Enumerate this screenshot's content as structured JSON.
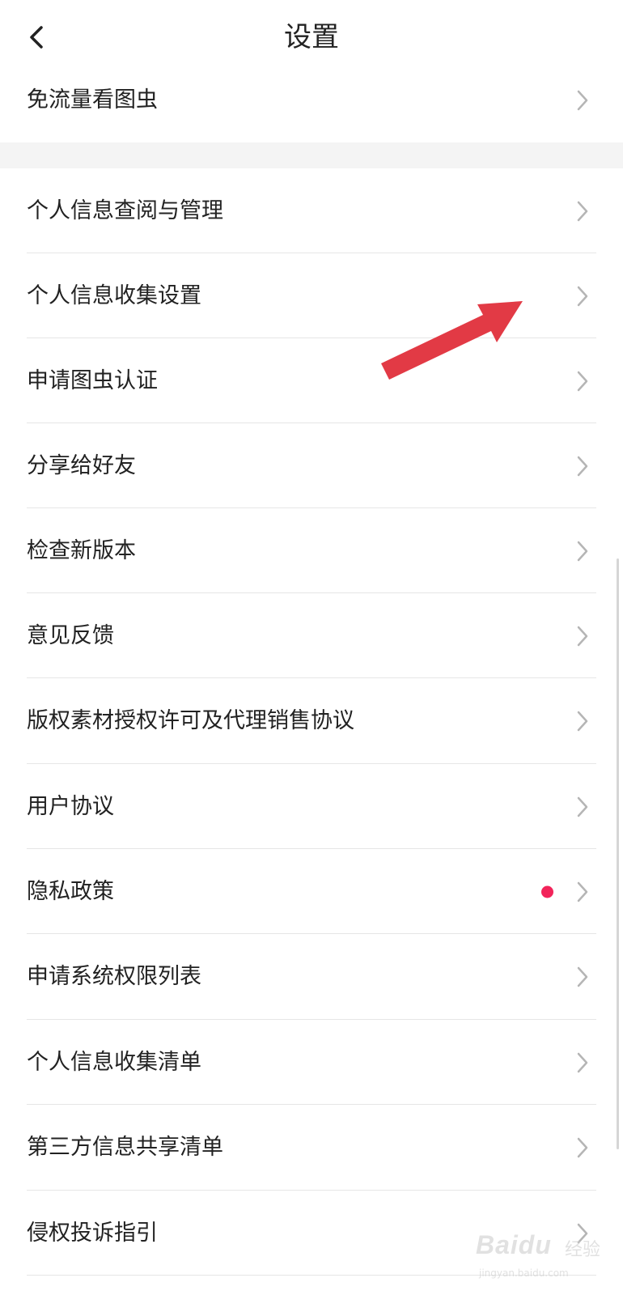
{
  "header": {
    "title": "设置",
    "back_icon": "chevron-left-icon"
  },
  "rows": [
    {
      "label": "免流量看图虫"
    },
    {
      "label": "个人信息查阅与管理"
    },
    {
      "label": "个人信息收集设置"
    },
    {
      "label": "申请图虫认证"
    },
    {
      "label": "分享给好友"
    },
    {
      "label": "检查新版本"
    },
    {
      "label": "意见反馈"
    },
    {
      "label": "版权素材授权许可及代理销售协议"
    },
    {
      "label": "用户协议"
    },
    {
      "label": "隐私政策",
      "badge": "red-dot"
    },
    {
      "label": "申请系统权限列表"
    },
    {
      "label": "个人信息收集清单"
    },
    {
      "label": "第三方信息共享清单"
    },
    {
      "label": "侵权投诉指引"
    }
  ],
  "annotation": {
    "icon": "red-arrow-icon",
    "color": "#e23a45"
  },
  "watermark": {
    "brand": "Baidu",
    "cn": "经验",
    "url": "jingyan.baidu.com"
  },
  "colors": {
    "badge": "#f2245a",
    "divider": "#e6e6e6",
    "section_gap": "#f4f4f4"
  }
}
